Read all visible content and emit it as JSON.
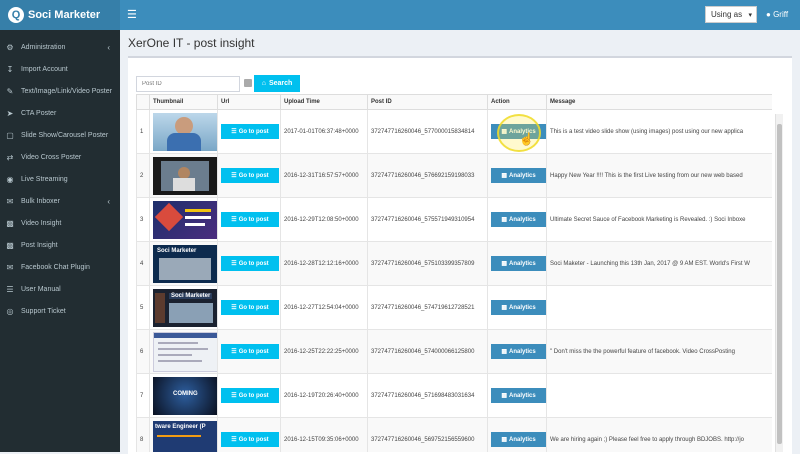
{
  "header": {
    "app_name": "Soci Marketer",
    "logo_letter": "Q",
    "using_as": "Using as",
    "user_name": "Griff"
  },
  "sidebar": {
    "items": [
      {
        "label": "Administration",
        "icon": "gear-icon",
        "has_caret": true
      },
      {
        "label": "Import Account",
        "icon": "download-icon"
      },
      {
        "label": "Text/Image/Link/Video Poster",
        "icon": "edit-icon"
      },
      {
        "label": "CTA Poster",
        "icon": "send-icon"
      },
      {
        "label": "Slide Show/Carousel Poster",
        "icon": "slides-icon"
      },
      {
        "label": "Video Cross Poster",
        "icon": "shuffle-icon"
      },
      {
        "label": "Live Streaming",
        "icon": "broadcast-icon"
      },
      {
        "label": "Bulk Inboxer",
        "icon": "inbox-icon",
        "has_caret": true
      },
      {
        "label": "Video Insight",
        "icon": "chart-icon"
      },
      {
        "label": "Post Insight",
        "icon": "chart-icon"
      },
      {
        "label": "Facebook Chat Plugin",
        "icon": "chat-icon"
      },
      {
        "label": "User Manual",
        "icon": "book-icon"
      },
      {
        "label": "Support Ticket",
        "icon": "ticket-icon"
      }
    ]
  },
  "page": {
    "title": "XerOne IT - post insight"
  },
  "search": {
    "placeholder": "Post ID",
    "button_label": "Search"
  },
  "table": {
    "columns": [
      "",
      "Thumbnail",
      "Url",
      "Upload Time",
      "Post ID",
      "Action",
      "Message"
    ],
    "goto_label": "Go to post",
    "analytics_label": "Analytics",
    "rows": [
      {
        "num": "1",
        "time": "2017-01-01T06:37:48+0000",
        "post_id": "372747716260046_577000015834814",
        "message": "This is a test video slide show (using images) post using our new applica",
        "thumb": "person"
      },
      {
        "num": "2",
        "time": "2016-12-31T16:57:57+0000",
        "post_id": "372747716260046_576692159198033",
        "message": "Happy New Year !!!! This is the first Live testing from our new web based",
        "thumb": "person2"
      },
      {
        "num": "3",
        "time": "2016-12-29T12:08:50+0000",
        "post_id": "372747716260046_575571949310954",
        "message": "Ultimate Secret Sauce of Facebook Marketing is Revealed. :) Soci Inboxe",
        "thumb": "promo"
      },
      {
        "num": "4",
        "time": "2016-12-28T12:12:16+0000",
        "post_id": "372747716260046_575103399357809",
        "message": "Soci Maketer - Launching this 13th Jan, 2017 @ 9 AM EST. World's First W",
        "thumb": "soci"
      },
      {
        "num": "5",
        "time": "2016-12-27T12:54:04+0000",
        "post_id": "372747716260046_574719612728521",
        "message": "",
        "thumb": "soci2"
      },
      {
        "num": "6",
        "time": "2016-12-25T22:22:25+0000",
        "post_id": "372747716260046_574000066125800",
        "message": "\" Don't miss the the powerful feature of facebook. Video CrossPosting",
        "thumb": "screen"
      },
      {
        "num": "7",
        "time": "2016-12-19T20:26:40+0000",
        "post_id": "372747716260046_571698483031634",
        "message": "",
        "thumb": "coming"
      },
      {
        "num": "8",
        "time": "2016-12-15T09:35:06+0000",
        "post_id": "372747716260046_569752156559600",
        "message": "We are hiring again ;) Please feel free to apply through BDJOBS. http://jo",
        "thumb": "hiring"
      }
    ]
  },
  "thumb_text": {
    "soci": "Soci Marketer",
    "soci2": "Soci Marketer",
    "coming": "COMING",
    "hiring": "tware Engineer (P"
  }
}
